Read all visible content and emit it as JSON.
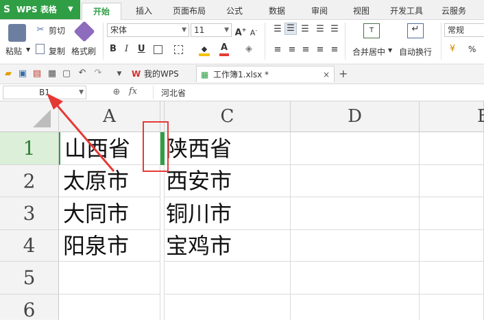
{
  "app": {
    "name": "WPS 表格"
  },
  "tabs": [
    "开始",
    "插入",
    "页面布局",
    "公式",
    "数据",
    "审阅",
    "视图",
    "开发工具",
    "云服务"
  ],
  "ribbon": {
    "paste": "粘贴",
    "cut": "剪切",
    "copy": "复制",
    "format_painter": "格式刷",
    "font_name": "宋体",
    "font_size": "11",
    "bold": "B",
    "italic": "I",
    "underline": "U",
    "merge_center": "合并居中",
    "wrap_text": "自动换行",
    "number_format": "常规",
    "percent": "%"
  },
  "quickbar": {
    "wps_tab": "我的WPS",
    "doc_tab": "工作簿1.xlsx *",
    "close": "×",
    "new_tab": "+"
  },
  "formula_bar": {
    "name_box": "B1",
    "fx": "fx",
    "value": "河北省"
  },
  "sheet": {
    "columns": [
      "A",
      "C",
      "D",
      "E"
    ],
    "rows": [
      "1",
      "2",
      "3",
      "4",
      "5",
      "6"
    ],
    "cells_a": [
      "山西省",
      "太原市",
      "大同市",
      "阳泉市",
      "",
      ""
    ],
    "cells_c": [
      "陕西省",
      "西安市",
      "铜川市",
      "宝鸡市",
      "",
      ""
    ]
  },
  "colors": {
    "accent": "#2f9e44",
    "annotation": "#e53935"
  }
}
